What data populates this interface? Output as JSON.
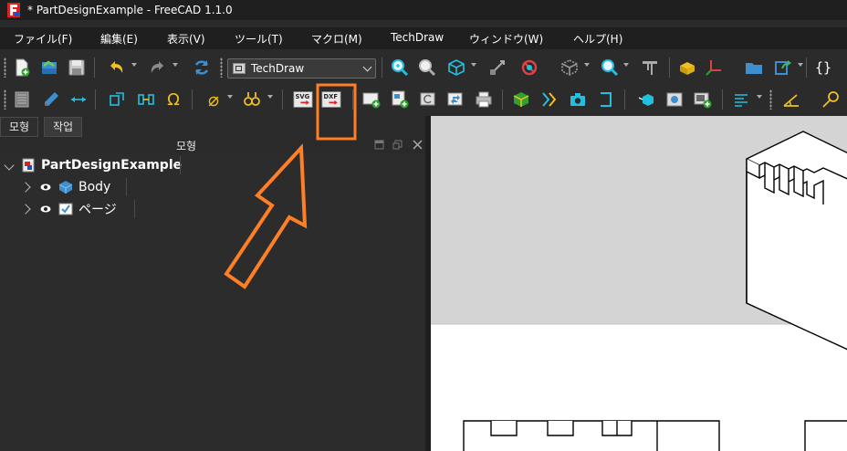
{
  "window": {
    "title": "* PartDesignExample - FreeCAD 1.1.0"
  },
  "menu": [
    {
      "label": "ファイル(F)"
    },
    {
      "label": "編集(E)"
    },
    {
      "label": "表示(V)"
    },
    {
      "label": "ツール(T)"
    },
    {
      "label": "マクロ(M)"
    },
    {
      "label": "TechDraw"
    },
    {
      "label": "ウィンドウ(W)"
    },
    {
      "label": "ヘルプ(H)"
    }
  ],
  "toolbar": {
    "workbench_selected": "TechDraw",
    "export_svg_label": "SVG",
    "export_dxf_label": "DXF",
    "omega_glyph": "Ω",
    "diameter_glyph": "⌀",
    "braces_glyph": "{}"
  },
  "tabs": [
    {
      "label": "모형"
    },
    {
      "label": "작업"
    }
  ],
  "panel": {
    "title": "모형"
  },
  "tree": {
    "root": {
      "label": "PartDesignExample"
    },
    "children": [
      {
        "label": "Body",
        "icon": "body-icon"
      },
      {
        "label": "ページ",
        "icon": "page-icon"
      }
    ]
  },
  "colors": {
    "annotation": "#ff7f27",
    "accent_cyan": "#22c0e0",
    "accent_yellow": "#f0c020",
    "page_bg": "#d4d4d4"
  }
}
